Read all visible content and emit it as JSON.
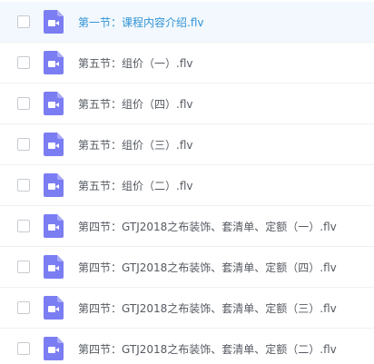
{
  "colors": {
    "selected_row_bg": "#f2f8fd",
    "selected_text": "#3194d5",
    "text": "#555a61",
    "icon_purple": "#7b7df3"
  },
  "files": [
    {
      "name": "第一节：课程内容介绍.flv",
      "selected": true,
      "checked": false,
      "icon": "video-file-icon"
    },
    {
      "name": "第五节：组价（一）.flv",
      "selected": false,
      "checked": false,
      "icon": "video-file-icon"
    },
    {
      "name": "第五节：组价（四）.flv",
      "selected": false,
      "checked": false,
      "icon": "video-file-icon"
    },
    {
      "name": "第五节：组价（三）.flv",
      "selected": false,
      "checked": false,
      "icon": "video-file-icon"
    },
    {
      "name": "第五节：组价（二）.flv",
      "selected": false,
      "checked": false,
      "icon": "video-file-icon"
    },
    {
      "name": "第四节：GTJ2018之布装饰、套清单、定额（一）.flv",
      "selected": false,
      "checked": false,
      "icon": "video-file-icon"
    },
    {
      "name": "第四节：GTJ2018之布装饰、套清单、定额（四）.flv",
      "selected": false,
      "checked": false,
      "icon": "video-file-icon"
    },
    {
      "name": "第四节：GTJ2018之布装饰、套清单、定额（三）.flv",
      "selected": false,
      "checked": false,
      "icon": "video-file-icon"
    },
    {
      "name": "第四节：GTJ2018之布装饰、套清单、定额（二）.flv",
      "selected": false,
      "checked": false,
      "icon": "video-file-icon"
    }
  ]
}
